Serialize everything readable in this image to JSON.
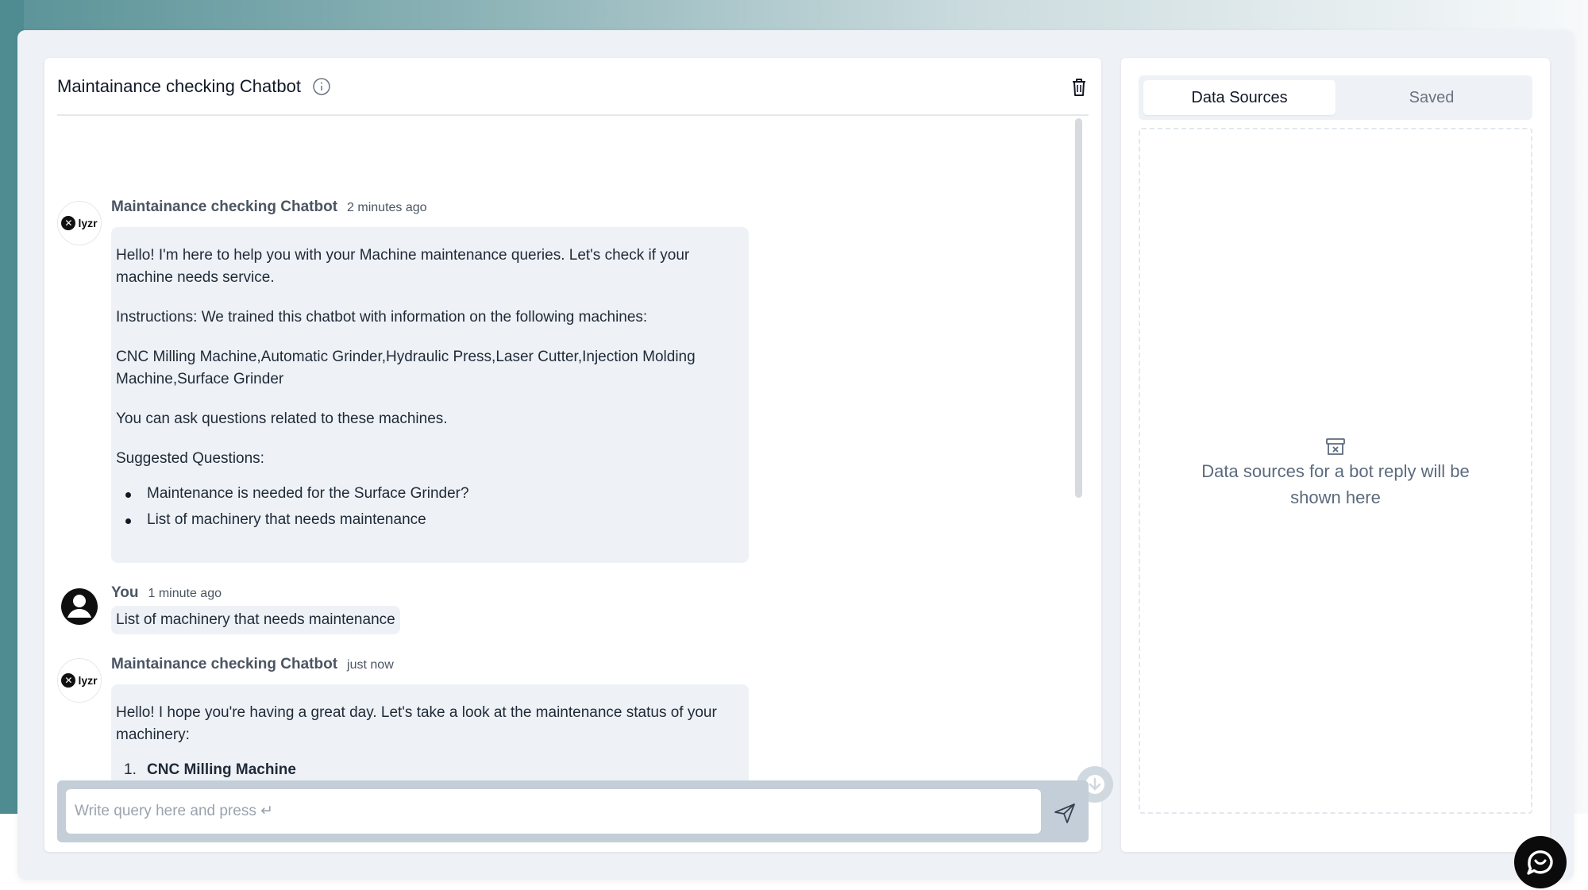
{
  "chat": {
    "title": "Maintainance checking Chatbot",
    "messages": [
      {
        "author": "Maintainance checking Chatbot",
        "time": "2 minutes ago",
        "avatar_text": "lyzr",
        "paragraphs": [
          "Hello! I'm here to help you with your Machine maintenance queries. Let's check if your machine needs service.",
          "Instructions: We trained this chatbot with information on the following machines:",
          "CNC Milling Machine,Automatic Grinder,Hydraulic Press,Laser Cutter,Injection Molding Machine,Surface Grinder",
          "You can ask questions related to these machines.",
          "Suggested Questions:"
        ],
        "suggestions": [
          "Maintenance is needed for the Surface Grinder?",
          "List of machinery that needs maintenance"
        ]
      },
      {
        "author": "You",
        "time": "1 minute ago",
        "text": "List of machinery that needs maintenance"
      },
      {
        "author": "Maintainance checking Chatbot",
        "time": "just now",
        "avatar_text": "lyzr",
        "paragraphs": [
          "Hello! I hope you're having a great day. Let's take a look at the maintenance status of your machinery:"
        ],
        "list": [
          {
            "num": "1.",
            "label": "CNC Milling Machine"
          }
        ]
      }
    ],
    "composer": {
      "placeholder": "Write query here and press ↵"
    }
  },
  "side": {
    "tabs": [
      "Data Sources",
      "Saved"
    ],
    "active_tab": "Data Sources",
    "empty_text": "Data sources for a bot reply will be shown here"
  },
  "icons": {
    "info": "info-icon",
    "trash": "trash-icon",
    "send": "send-icon",
    "scroll_down": "arrow-down-icon",
    "archive": "archive-x-icon",
    "help": "chat-help-icon",
    "user": "user-avatar-icon"
  },
  "colors": {
    "bubble_bg": "#eef2f6",
    "composer_bg": "#c3ced8",
    "text_muted": "#5b6b7d"
  }
}
